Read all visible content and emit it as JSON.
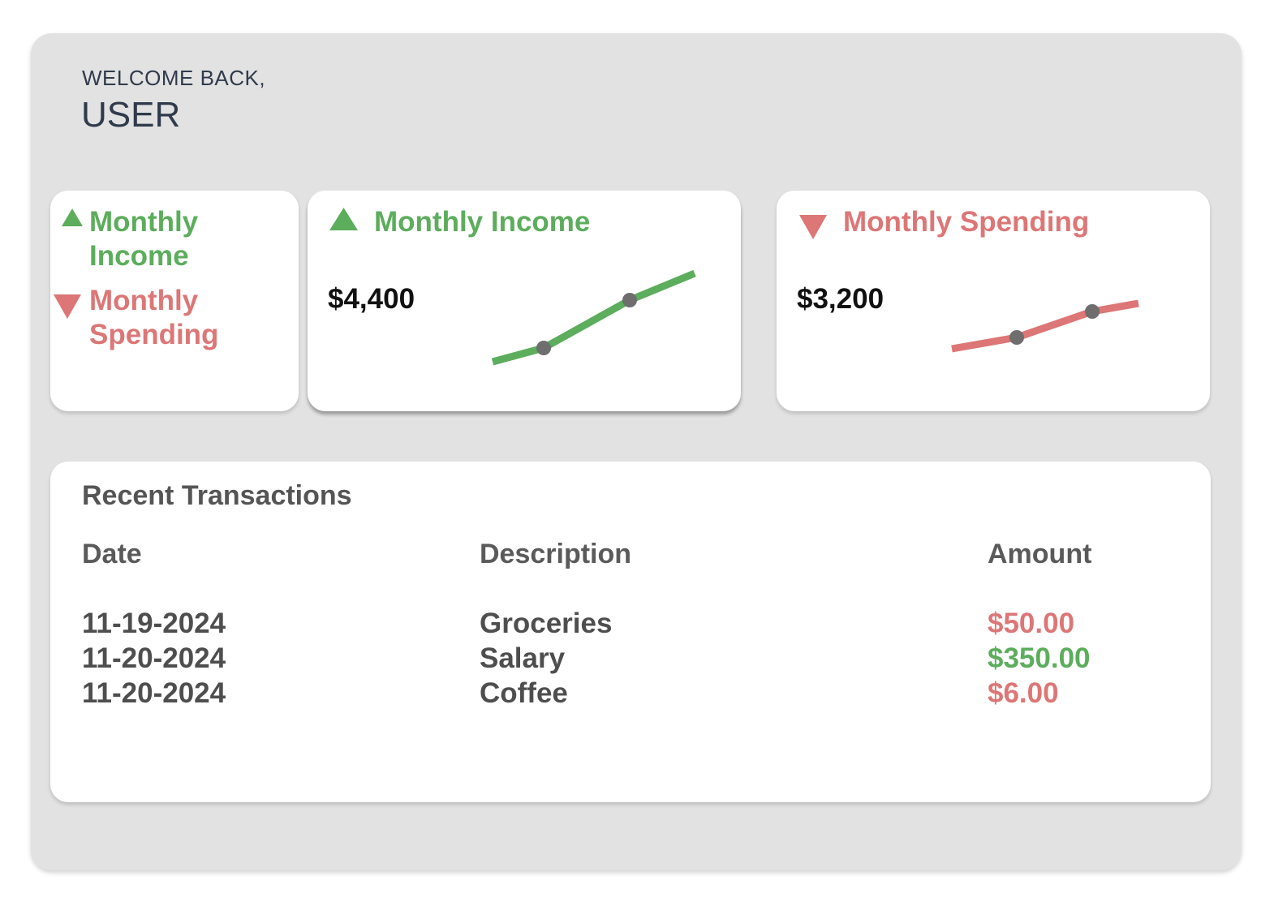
{
  "header": {
    "welcome": "WELCOME BACK,",
    "user": "USER"
  },
  "legend": {
    "income_label": "Monthly Income",
    "spending_label": "Monthly Spending",
    "income_icon": "triangle-up-icon",
    "spending_icon": "triangle-down-icon"
  },
  "income_card": {
    "title": "Monthly Income",
    "amount": "$4,400",
    "icon": "triangle-up-icon"
  },
  "spending_card": {
    "title": "Monthly Spending",
    "amount": "$3,200",
    "icon": "triangle-down-icon"
  },
  "colors": {
    "income": "#5cad5c",
    "spending": "#dd7676",
    "marker": "#6e6e6e",
    "panel": "#e2e2e2"
  },
  "transactions": {
    "title": "Recent Transactions",
    "columns": [
      "Date",
      "Description",
      "Amount"
    ],
    "rows": [
      {
        "date": "11-19-2024",
        "description": "Groceries",
        "amount": "$50.00",
        "type": "spending"
      },
      {
        "date": "11-20-2024",
        "description": "Salary",
        "amount": "$350.00",
        "type": "income"
      },
      {
        "date": "11-20-2024",
        "description": "Coffee",
        "amount": "$6.00",
        "type": "spending"
      }
    ]
  }
}
